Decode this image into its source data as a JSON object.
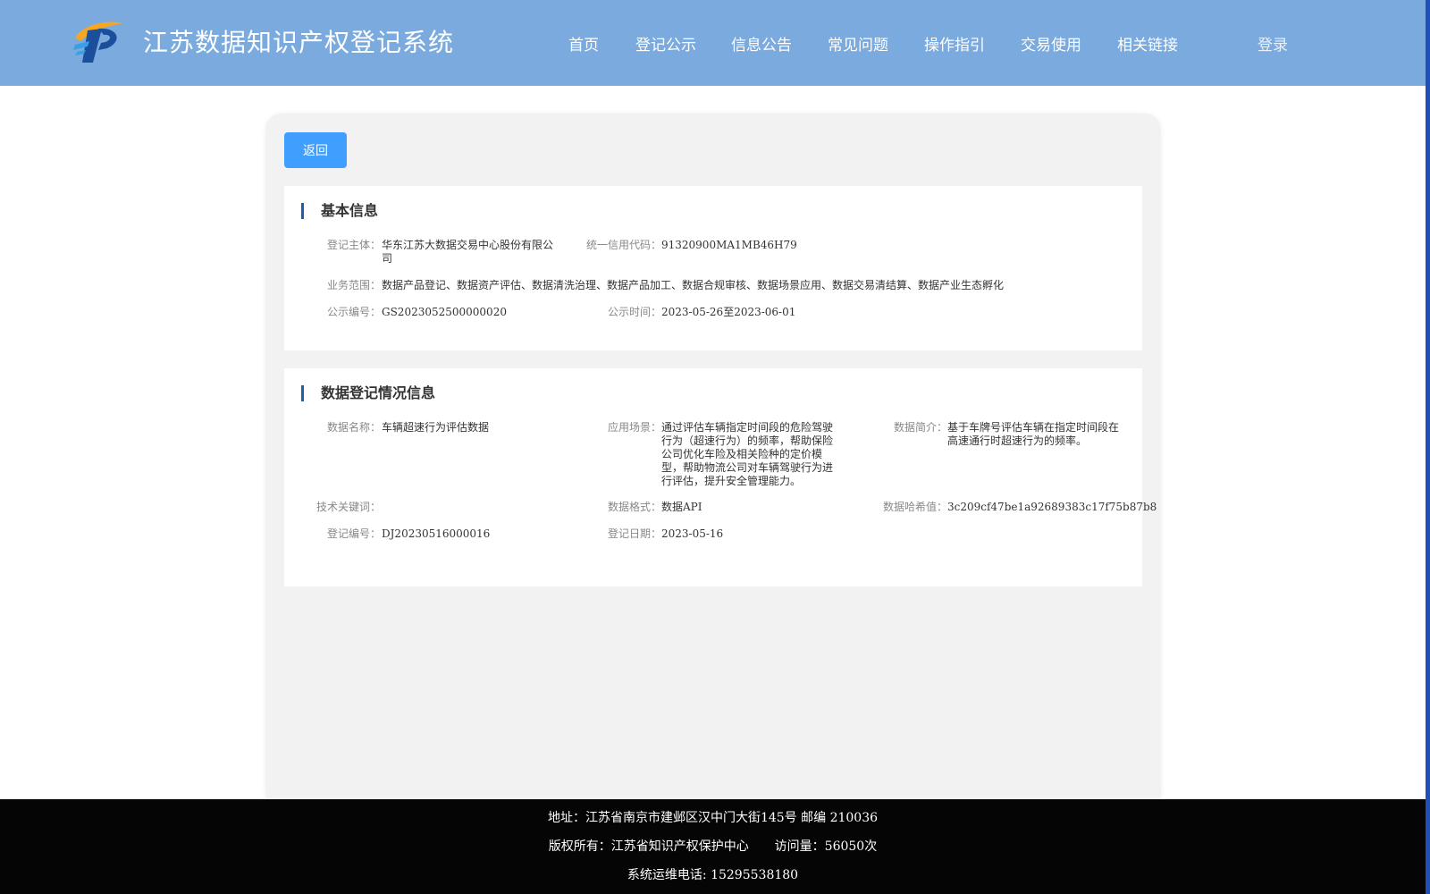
{
  "header": {
    "site_title": "江苏数据知识产权登记系统",
    "nav": [
      {
        "label": "首页"
      },
      {
        "label": "登记公示"
      },
      {
        "label": "信息公告"
      },
      {
        "label": "常见问题"
      },
      {
        "label": "操作指引"
      },
      {
        "label": "交易使用"
      },
      {
        "label": "相关链接"
      }
    ],
    "login": "登录"
  },
  "back_button": "返回",
  "basic_info": {
    "title": "基本信息",
    "entity_label": "登记主体：",
    "entity_value": "华东江苏大数据交易中心股份有限公司",
    "credit_label": "统一信用代码：",
    "credit_value": "91320900MA1MB46H79",
    "scope_label": "业务范围：",
    "scope_value": "数据产品登记、数据资产评估、数据清洗治理、数据产品加工、数据合规审核、数据场景应用、数据交易清结算、数据产业生态孵化",
    "notice_no_label": "公示编号：",
    "notice_no_value": "GS2023052500000020",
    "notice_time_label": "公示时间：",
    "notice_time_value": "2023-05-26至2023-06-01"
  },
  "registration_info": {
    "title": "数据登记情况信息",
    "name_label": "数据名称：",
    "name_value": "车辆超速行为评估数据",
    "scene_label": "应用场景：",
    "scene_value": "通过评估车辆指定时间段的危险驾驶行为（超速行为）的频率，帮助保险公司优化车险及相关险种的定价模型，帮助物流公司对车辆驾驶行为进行评估，提升安全管理能力。",
    "intro_label": "数据简介：",
    "intro_value": "基于车牌号评估车辆在指定时间段在高速通行时超速行为的频率。",
    "keywords_label": "技术关键词：",
    "keywords_value": "",
    "format_label": "数据格式：",
    "format_value": "数据API",
    "hash_label": "数据哈希值：",
    "hash_value": "3c209cf47be1a92689383c17f75b87b8",
    "reg_no_label": "登记编号：",
    "reg_no_value": "DJ20230516000016",
    "reg_date_label": "登记日期：",
    "reg_date_value": "2023-05-16"
  },
  "footer": {
    "address": "地址：江苏省南京市建邺区汉中门大街145号 邮编 210036",
    "copyright": "版权所有：江苏省知识产权保护中心",
    "visits": "访问量：56050次",
    "phone": "系统运维电话: 15295538180"
  },
  "colors": {
    "header_bg": "#7aaade",
    "accent_button": "#409eff",
    "section_marker": "#1d5fa8",
    "footer_bg": "#050505"
  }
}
